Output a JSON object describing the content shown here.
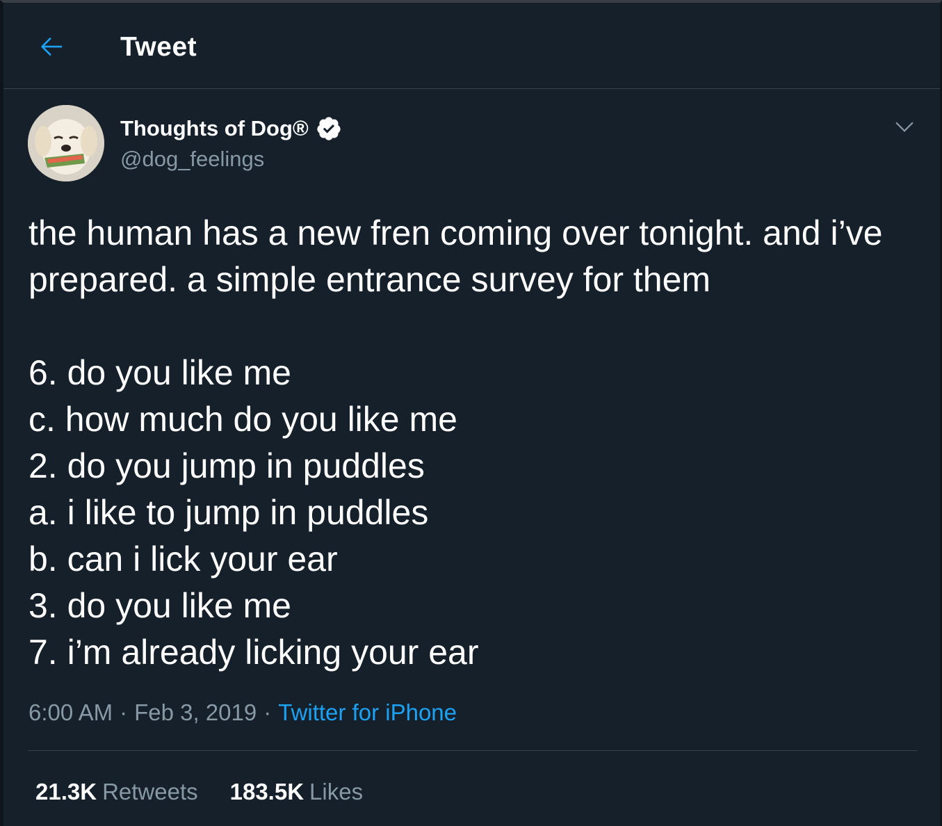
{
  "header": {
    "title": "Tweet",
    "back_icon": "arrow-left-icon",
    "accent_color": "#1da1f2"
  },
  "author": {
    "display_name": "Thoughts of Dog®",
    "handle": "@dog_feelings",
    "verified_icon": "verified-badge-icon",
    "avatar_icon": "dog-avatar"
  },
  "tweet": {
    "text": "the human has a new fren coming over tonight. and i’ve prepared. a simple entrance survey for them\n\n6. do you like me\nc. how much do you like me\n2. do you jump in puddles\na. i like to jump in puddles\nb. can i lick your ear\n3. do you like me\n7. i’m already licking your ear",
    "time": "6:00 AM",
    "separator": "·",
    "date": "Feb 3, 2019",
    "source": "Twitter for iPhone"
  },
  "stats": {
    "retweets_count": "21.3K",
    "retweets_label": "Retweets",
    "likes_count": "183.5K",
    "likes_label": "Likes"
  },
  "colors": {
    "background": "#15202b",
    "border": "#38444d",
    "secondary_text": "#8899a6",
    "link": "#1da1f2"
  }
}
